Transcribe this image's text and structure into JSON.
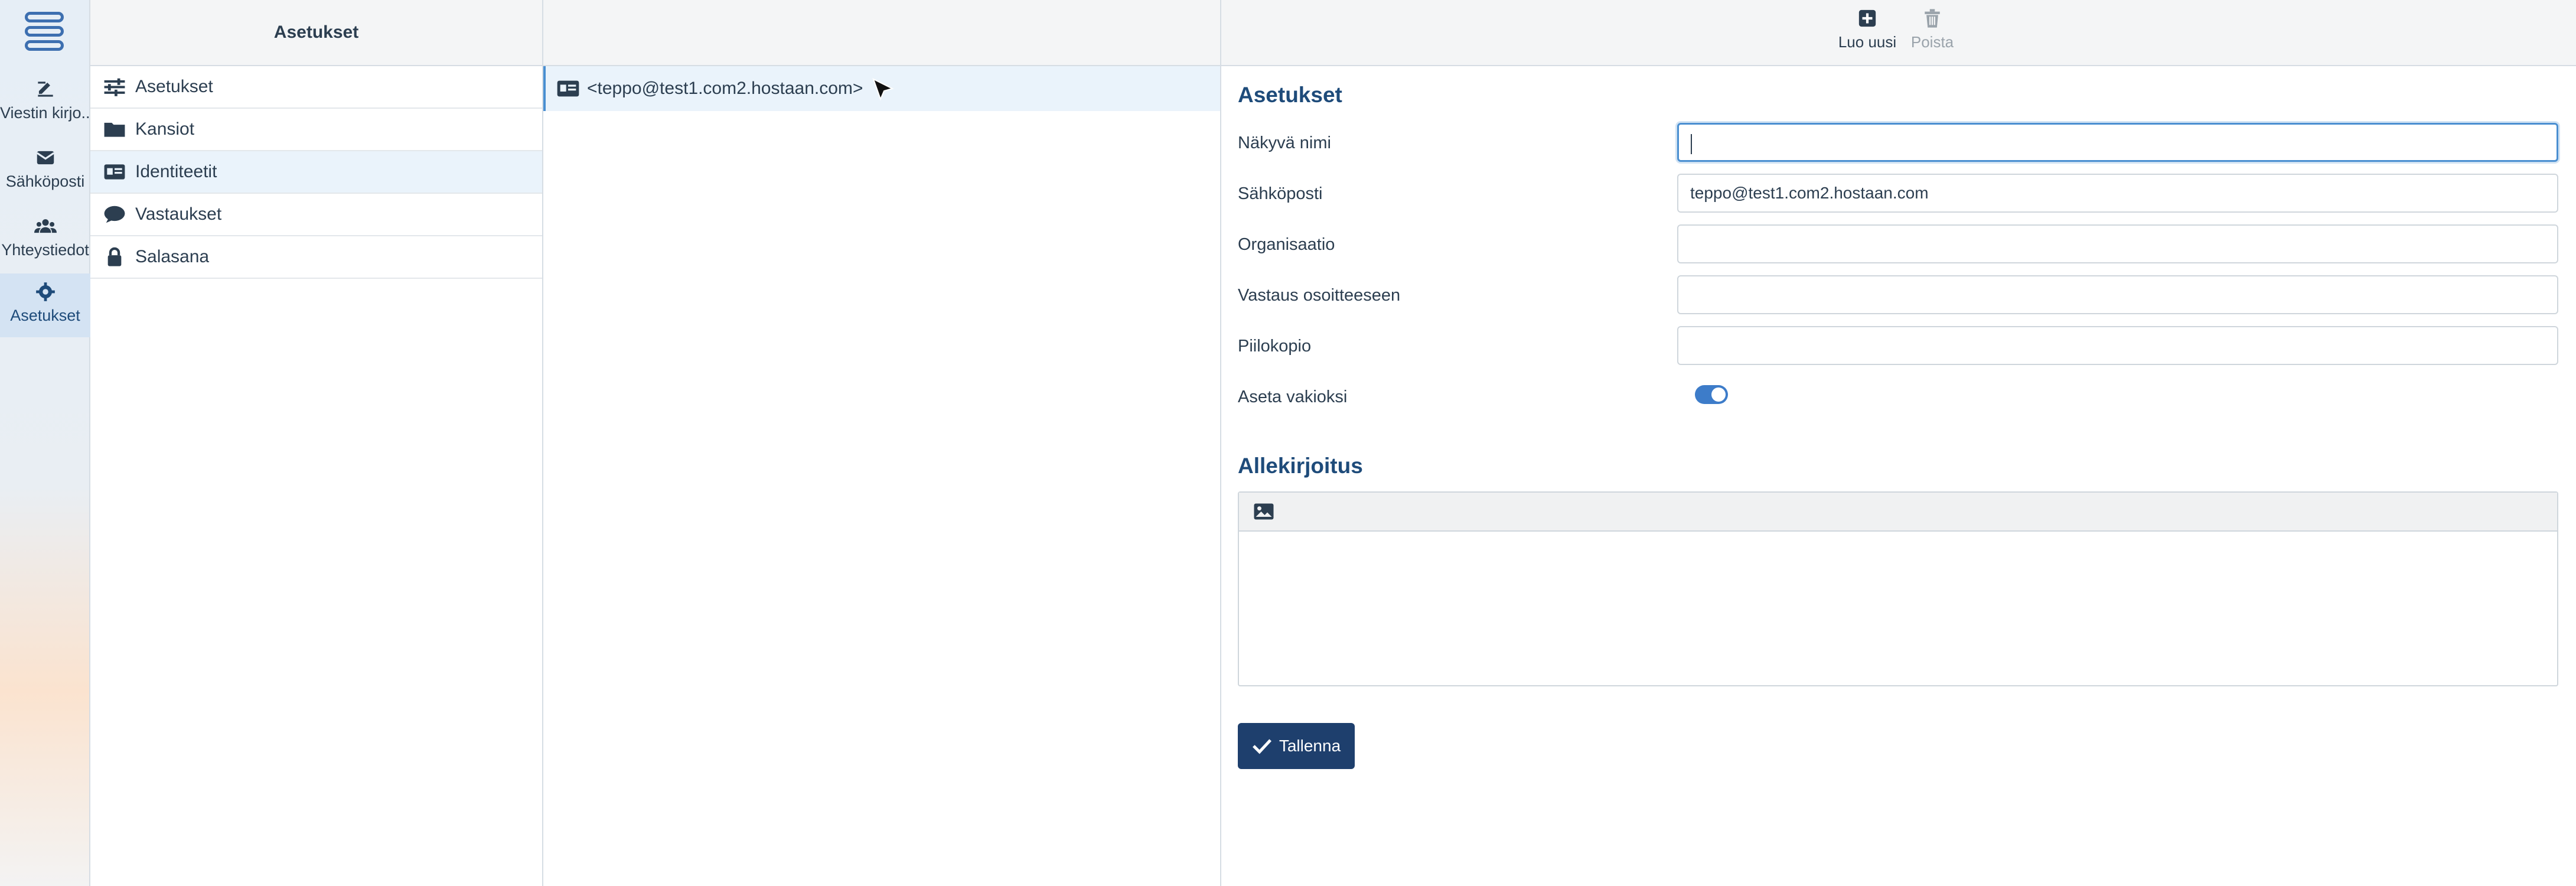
{
  "rail": {
    "items": [
      {
        "label": "Viestin kirjo...",
        "icon": "compose-icon"
      },
      {
        "label": "Sähköposti",
        "icon": "mail-icon"
      },
      {
        "label": "Yhteystiedot",
        "icon": "contacts-icon"
      },
      {
        "label": "Asetukset",
        "icon": "gear-icon"
      }
    ],
    "active": "Asetukset"
  },
  "settings_pane": {
    "title": "Asetukset",
    "items": [
      {
        "label": "Asetukset",
        "icon": "sliders-icon"
      },
      {
        "label": "Kansiot",
        "icon": "folder-icon"
      },
      {
        "label": "Identiteetit",
        "icon": "id-card-icon"
      },
      {
        "label": "Vastaukset",
        "icon": "comment-icon"
      },
      {
        "label": "Salasana",
        "icon": "lock-icon"
      }
    ],
    "selected": "Identiteetit"
  },
  "identities": {
    "items": [
      {
        "label": "<teppo@test1.com2.hostaan.com>"
      }
    ]
  },
  "toolbar": {
    "create_label": "Luo uusi",
    "delete_label": "Poista"
  },
  "form": {
    "section_title": "Asetukset",
    "fields": {
      "display_name": {
        "label": "Näkyvä nimi",
        "value": ""
      },
      "email": {
        "label": "Sähköposti",
        "value": "teppo@test1.com2.hostaan.com"
      },
      "organization": {
        "label": "Organisaatio",
        "value": ""
      },
      "reply_to": {
        "label": "Vastaus osoitteeseen",
        "value": ""
      },
      "bcc": {
        "label": "Piilokopio",
        "value": ""
      },
      "default": {
        "label": "Aseta vakioksi",
        "value": true
      }
    },
    "signature_title": "Allekirjoitus",
    "save_label": "Tallenna"
  },
  "colors": {
    "accent": "#1e3f6d",
    "link": "#1e4b7a",
    "selection": "#eaf3fb",
    "toggle": "#3d7cc9"
  }
}
